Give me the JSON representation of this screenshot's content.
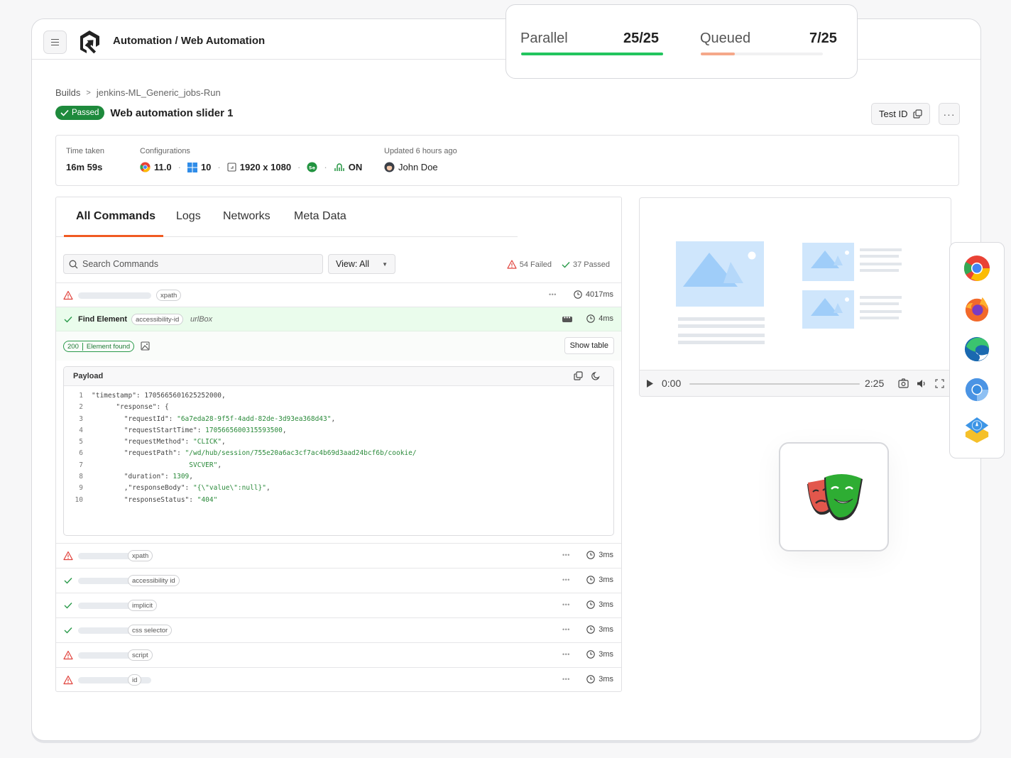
{
  "header": {
    "menu_icon": "hamburger-menu-icon",
    "logo": "lambdatest-logo",
    "title": "Automation / Web Automation"
  },
  "breadcrumb": {
    "root": "Builds",
    "current": "jenkins-ML_Generic_jobs-Run"
  },
  "test": {
    "status": "Passed",
    "status_color": "#1e8a3c",
    "title": "Web automation slider 1",
    "test_id_label": "Test ID",
    "more_label": "···"
  },
  "info": {
    "time_taken_label": "Time taken",
    "time_taken": "16m 59s",
    "configurations_label": "Configurations",
    "browser_version": "11.0",
    "os_version": "10",
    "resolution": "1920 x 1080",
    "tunnel": "ON",
    "updated_label": "Updated 6 hours ago",
    "user": "John Doe"
  },
  "concurrency": {
    "parallel_label": "Parallel",
    "parallel_value": "25/25",
    "parallel_fraction": 1.0,
    "parallel_color": "#22c55e",
    "queued_label": "Queued",
    "queued_value": "7/25",
    "queued_fraction": 0.28,
    "queued_color": "#f5a88a"
  },
  "tabs": [
    {
      "label": "All Commands",
      "active": true
    },
    {
      "label": "Logs",
      "active": false
    },
    {
      "label": "Networks",
      "active": false
    },
    {
      "label": "Meta Data",
      "active": false
    }
  ],
  "accent_color": "#f05a22",
  "toolbar": {
    "search_placeholder": "Search Commands",
    "view_label": "View: All",
    "failed_count": "54 Failed",
    "passed_count": "37 Passed"
  },
  "commands": [
    {
      "status": "failed",
      "locator": "xpath",
      "duration": "4017ms"
    },
    {
      "status": "passed",
      "name": "Find Element",
      "locator": "accessibility-id",
      "value": "urlBox",
      "duration": "4ms",
      "expanded": true
    },
    {
      "status": "failed",
      "locator": "xpath",
      "duration": "3ms"
    },
    {
      "status": "passed",
      "locator": "accessibility id",
      "duration": "3ms"
    },
    {
      "status": "passed",
      "locator": "implicit",
      "duration": "3ms"
    },
    {
      "status": "passed",
      "locator": "css selector",
      "duration": "3ms"
    },
    {
      "status": "failed",
      "locator": "script",
      "duration": "3ms"
    },
    {
      "status": "failed",
      "locator": "id",
      "duration": "3ms"
    }
  ],
  "expanded": {
    "status_code": "200",
    "status_text": "Element found",
    "show_table_label": "Show table",
    "payload_title": "Payload",
    "lines": [
      {
        "n": "1",
        "pre": "\"timestamp\": 1705665601625252000,",
        "val": ""
      },
      {
        "n": "2",
        "pre": "      \"response\": {",
        "val": ""
      },
      {
        "n": "3",
        "pre": "        \"requestId\": ",
        "val": "\"6a7eda28-9f5f-4add-82de-3d93ea368d43\"",
        "post": ","
      },
      {
        "n": "4",
        "pre": "        \"requestStartTime\": ",
        "val": "1705665600315593500",
        "post": ","
      },
      {
        "n": "5",
        "pre": "        \"requestMethod\": ",
        "val": "\"CLICK\"",
        "post": ","
      },
      {
        "n": "6",
        "pre": "        \"requestPath\": ",
        "val": "\"/wd/hub/session/755e20a6ac3cf7ac4b69d3aad24bcf6b/cookie/",
        "post": ""
      },
      {
        "n": "7",
        "pre": "                        ",
        "val": "SVCVER\"",
        "post": ","
      },
      {
        "n": "8",
        "pre": "        \"duration\": ",
        "val": "1309",
        "post": ","
      },
      {
        "n": "9",
        "pre": "        ,\"responseBody\": ",
        "val": "\"{\\\"value\\\":null}\"",
        "post": ","
      },
      {
        "n": "10",
        "pre": "        \"responseStatus\": ",
        "val": "\"404\"",
        "post": ""
      }
    ]
  },
  "video": {
    "current_time": "0:00",
    "duration": "2:25",
    "progress": 0
  },
  "browsers": [
    "chrome",
    "firefox",
    "edge",
    "chromium",
    "webkit"
  ],
  "framework": "playwright"
}
